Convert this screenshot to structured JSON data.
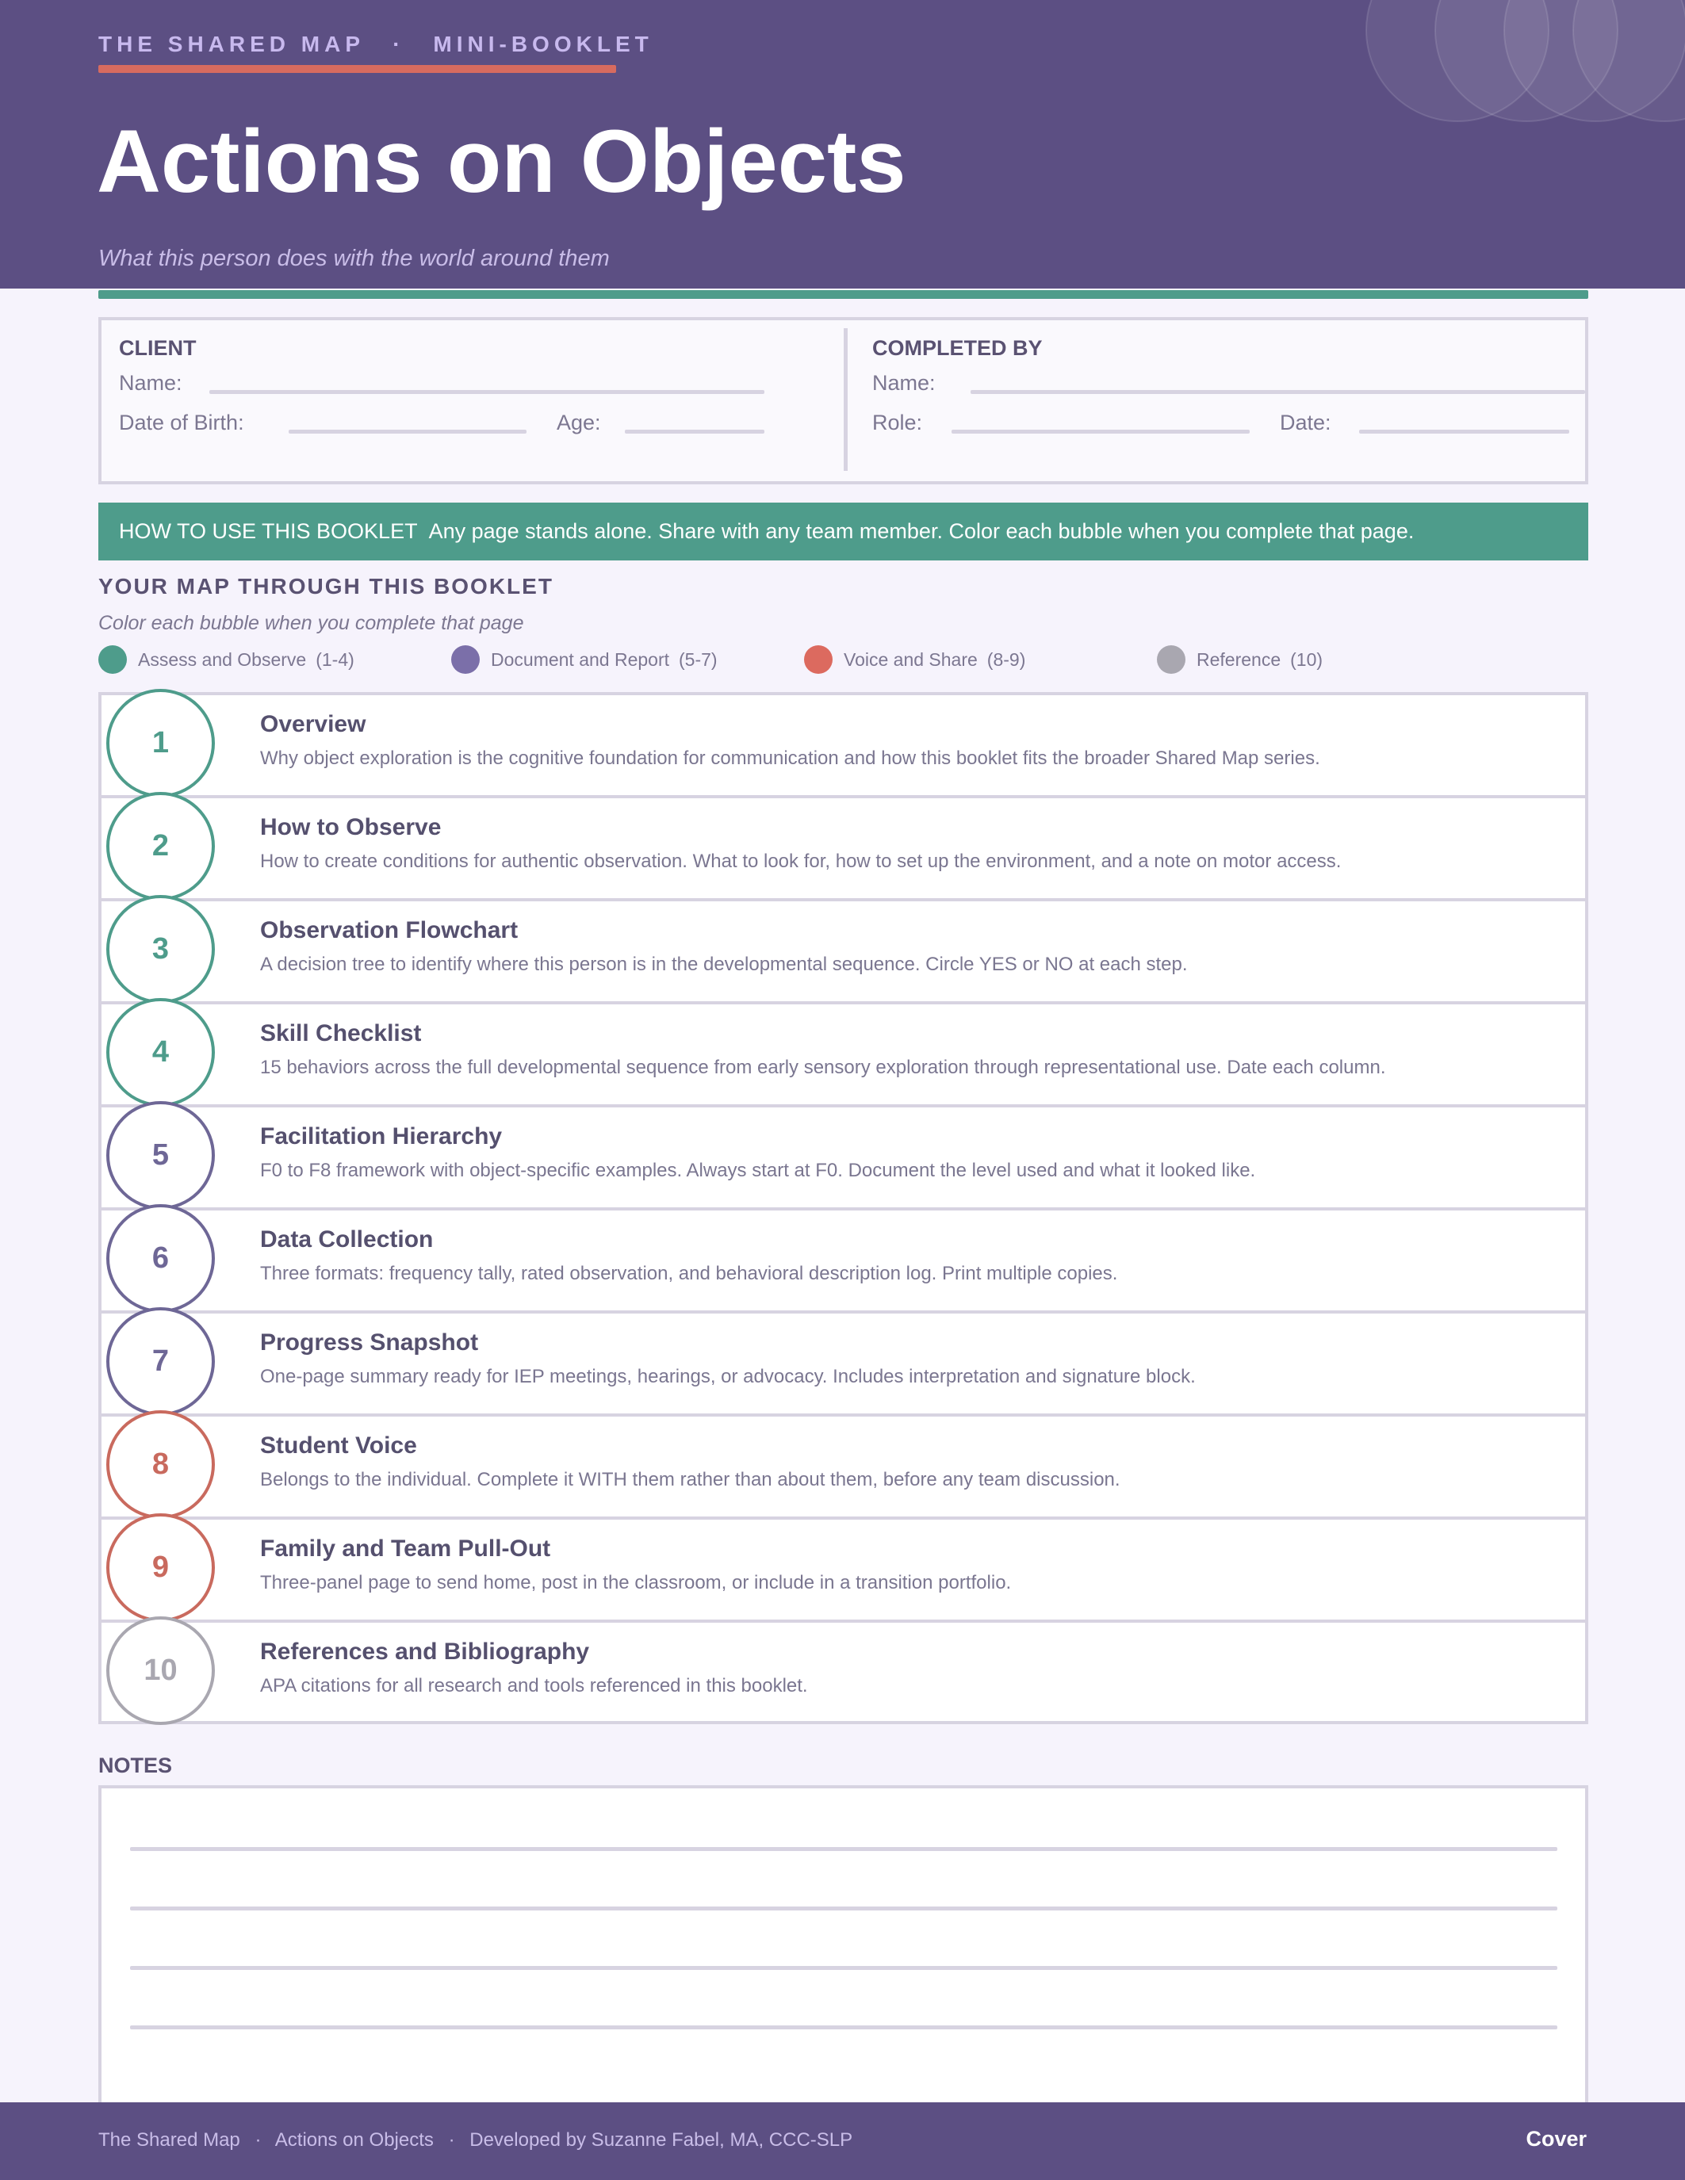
{
  "header": {
    "series": "THE SHARED MAP",
    "separator": "·",
    "format": "MINI-BOOKLET",
    "title": "Actions on Objects",
    "subtitle": "What this person does with the world around them"
  },
  "client": {
    "heading": "CLIENT",
    "name_label": "Name:",
    "dob_label": "Date of Birth:",
    "age_label": "Age:"
  },
  "completed_by": {
    "heading": "COMPLETED BY",
    "name_label": "Name:",
    "role_label": "Role:",
    "date_label": "Date:"
  },
  "howto": {
    "label": "HOW TO USE THIS BOOKLET",
    "text": "Any page stands alone. Share with any team member. Color each bubble when you complete that page."
  },
  "map": {
    "heading": "YOUR MAP THROUGH THIS BOOKLET",
    "subheading": "Color each bubble when you complete that page",
    "legend": [
      {
        "label": "Assess and Observe",
        "range": "(1-4)",
        "color": "#4e9c8b"
      },
      {
        "label": "Document and Report",
        "range": "(5-7)",
        "color": "#7b6fa9"
      },
      {
        "label": "Voice and Share",
        "range": "(8-9)",
        "color": "#dc6a5f"
      },
      {
        "label": "Reference",
        "range": "(10)",
        "color": "#a9a7b0"
      }
    ],
    "pages": [
      {
        "number": "1",
        "title": "Overview",
        "description": "Why object exploration is the cognitive foundation for communication and how this booklet fits the broader Shared Map series.",
        "color": "#4e9c8b"
      },
      {
        "number": "2",
        "title": "How to Observe",
        "description": "How to create conditions for authentic observation. What to look for, how to set up the environment, and a note on motor access.",
        "color": "#4e9c8b"
      },
      {
        "number": "3",
        "title": "Observation Flowchart",
        "description": "A decision tree to identify where this person is in the developmental sequence. Circle YES or NO at each step.",
        "color": "#4e9c8b"
      },
      {
        "number": "4",
        "title": "Skill Checklist",
        "description": "15 behaviors across the full developmental sequence from early sensory exploration through representational use. Date each column.",
        "color": "#4e9c8b"
      },
      {
        "number": "5",
        "title": "Facilitation Hierarchy",
        "description": "F0 to F8 framework with object-specific examples. Always start at F0. Document the level used and what it looked like.",
        "color": "#6e6796"
      },
      {
        "number": "6",
        "title": "Data Collection",
        "description": "Three formats: frequency tally, rated observation, and behavioral description log. Print multiple copies.",
        "color": "#6e6796"
      },
      {
        "number": "7",
        "title": "Progress Snapshot",
        "description": "One-page summary ready for IEP meetings, hearings, or advocacy. Includes interpretation and signature block.",
        "color": "#6e6796"
      },
      {
        "number": "8",
        "title": "Student Voice",
        "description": "Belongs to the individual. Complete it WITH them rather than about them, before any team discussion.",
        "color": "#c96a5e"
      },
      {
        "number": "9",
        "title": "Family and Team Pull-Out",
        "description": "Three-panel page to send home, post in the classroom, or include in a transition portfolio.",
        "color": "#c96a5e"
      },
      {
        "number": "10",
        "title": "References and Bibliography",
        "description": "APA citations for all research and tools referenced in this booklet.",
        "color": "#a9a7b0"
      }
    ]
  },
  "notes": {
    "label": "NOTES"
  },
  "footer": {
    "series": "The Shared Map",
    "booklet": "Actions on Objects",
    "credit": "Developed by Suzanne Fabel, MA, CCC-SLP",
    "separator": "·",
    "page_label": "Cover"
  }
}
